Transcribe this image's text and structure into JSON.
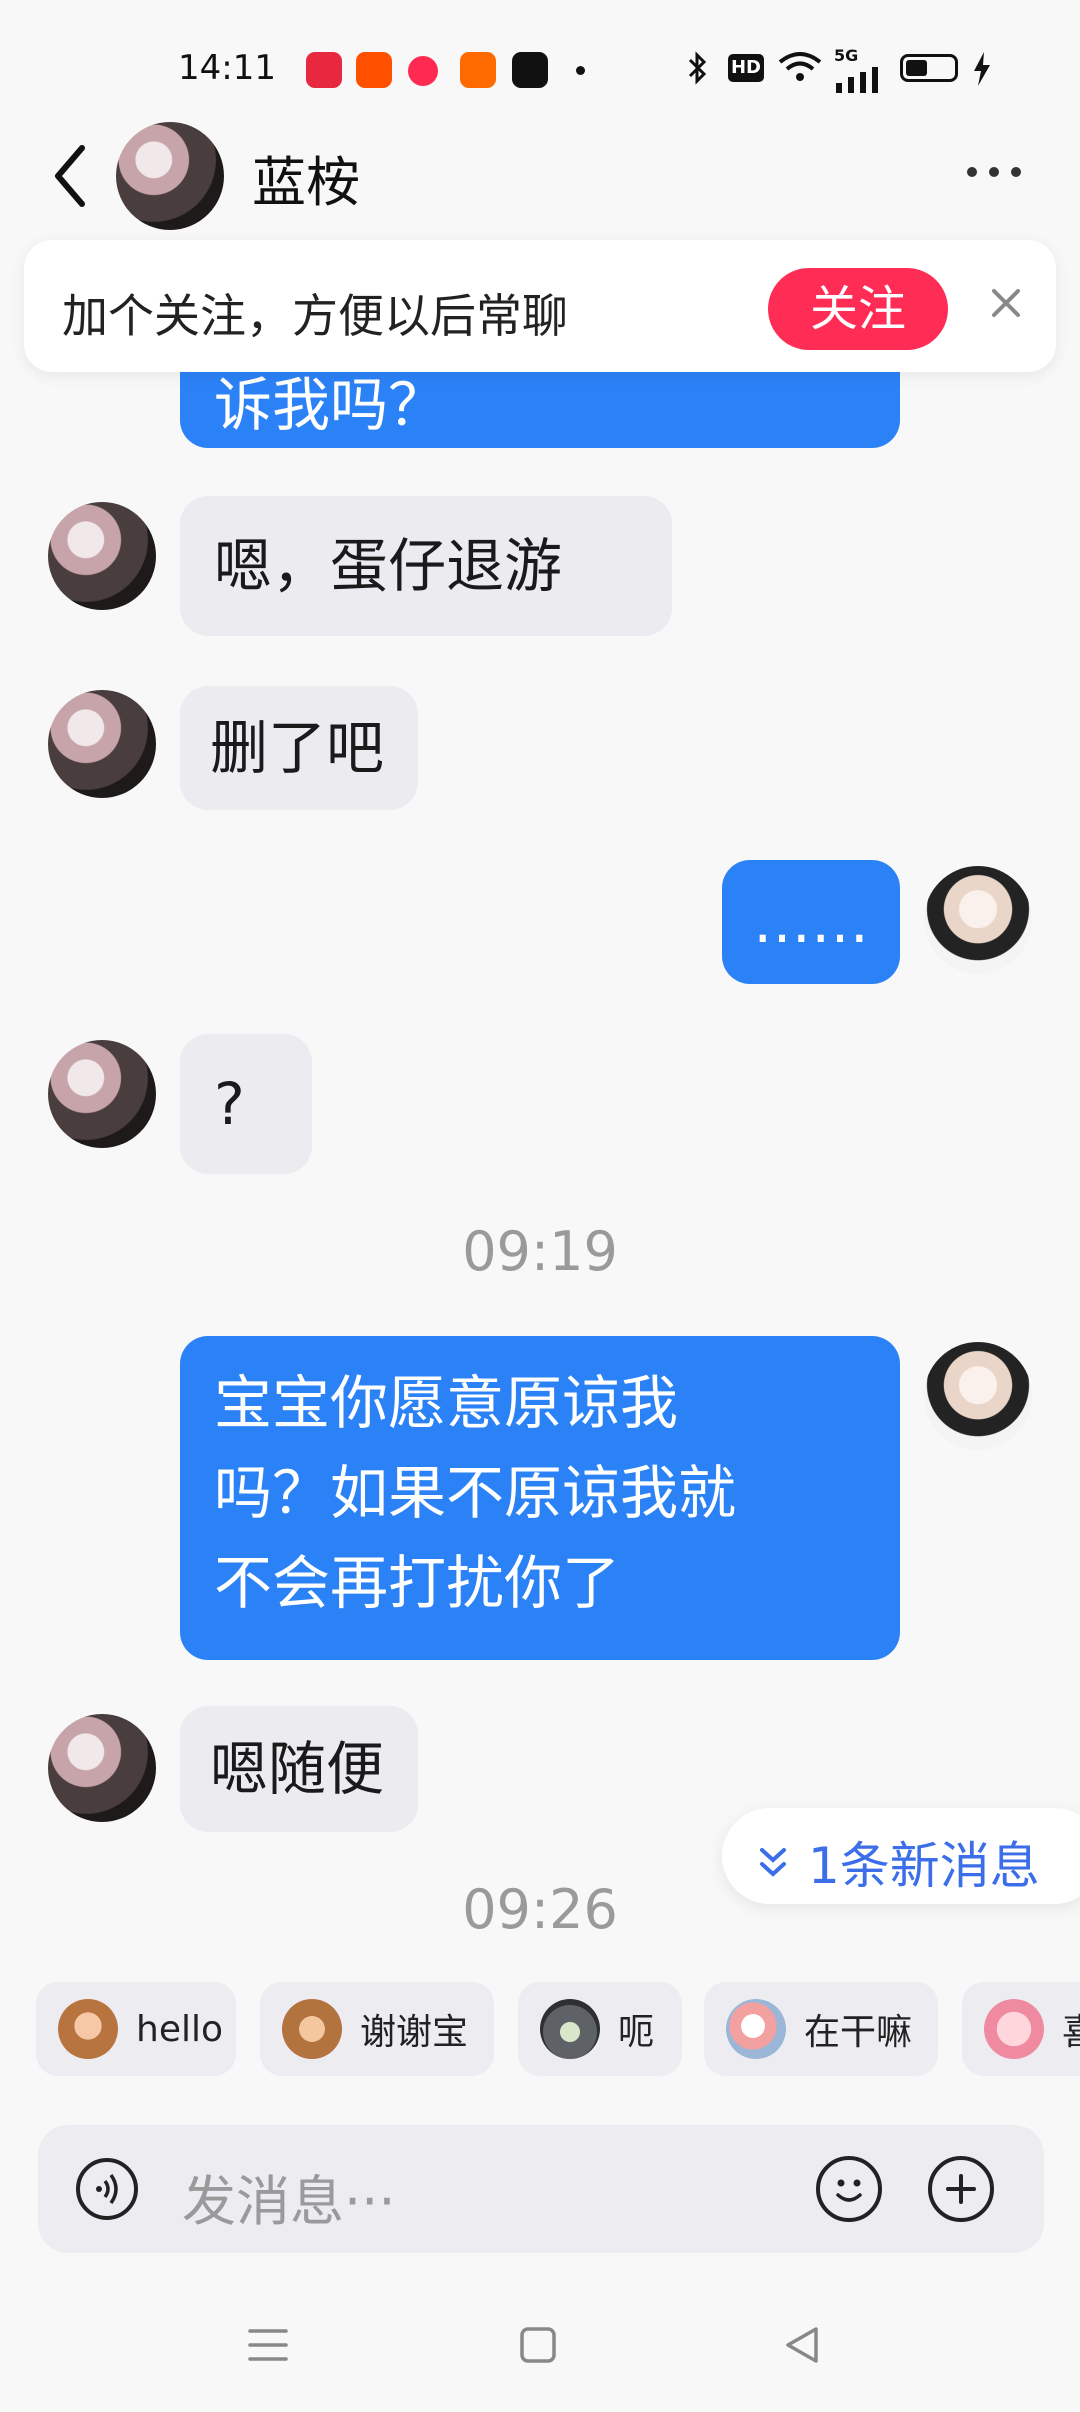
{
  "status_bar": {
    "time": "14:11",
    "network": "5G",
    "hd": "HD",
    "apps": [
      {
        "name": "xiaohongshu-app-icon",
        "color": "#e8283f"
      },
      {
        "name": "taobao-app-icon",
        "color": "#ff5000"
      },
      {
        "name": "red-app-icon",
        "color": "#ff2a52"
      },
      {
        "name": "kuaishou-app-icon",
        "color": "#ff6a00"
      },
      {
        "name": "tiktok-app-icon",
        "color": "#111111"
      }
    ],
    "battery_level": 0.4
  },
  "header": {
    "contact_name": "蓝桉",
    "back_icon": "chevron-left-icon",
    "more_icon": "more-horizontal-icon"
  },
  "follow_banner": {
    "text": "加个关注，方便以后常聊",
    "button_label": "关注",
    "close_icon": "close-icon"
  },
  "messages": [
    {
      "from": "me",
      "text": "诉我吗？",
      "partial": true
    },
    {
      "from": "other",
      "text": "嗯，蛋仔退游"
    },
    {
      "from": "other",
      "text": "删了吧"
    },
    {
      "from": "me",
      "text": "……"
    },
    {
      "from": "other",
      "text": "?"
    },
    {
      "type": "timestamp",
      "text": "09:19"
    },
    {
      "from": "me",
      "lines": [
        "宝宝你愿意原谅我",
        "吗？如果不原谅我就",
        "不会再打扰你了"
      ]
    },
    {
      "from": "other",
      "text": "嗯随便"
    },
    {
      "type": "timestamp",
      "text": "09:26"
    }
  ],
  "new_messages_pill": {
    "icon": "chevron-double-down-icon",
    "text": "1条新消息"
  },
  "quick_replies": [
    {
      "label": "hello",
      "icon": "monkey-sticker-icon"
    },
    {
      "label": "谢谢宝",
      "icon": "monkey-flower-sticker-icon"
    },
    {
      "label": "呃",
      "icon": "cat-sticker-icon"
    },
    {
      "label": "在干嘛",
      "icon": "peek-sticker-icon"
    },
    {
      "label": "喜",
      "icon": "pig-sticker-icon"
    }
  ],
  "composer": {
    "placeholder": "发消息···",
    "voice_icon": "voice-icon",
    "emoji_icon": "emoji-icon",
    "plus_icon": "plus-icon"
  },
  "nav_bar": {
    "menu_icon": "menu-icon",
    "home_icon": "home-square-icon",
    "back_icon": "back-triangle-icon"
  }
}
